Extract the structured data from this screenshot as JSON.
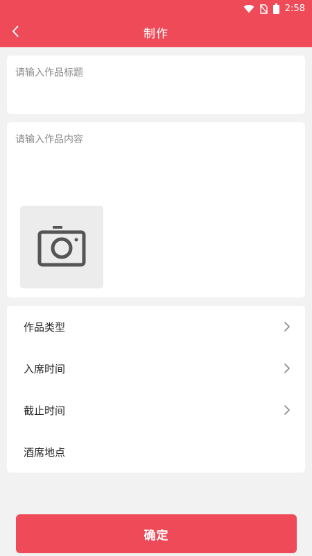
{
  "status_bar": {
    "time": "2:58",
    "icons": [
      "wifi-icon",
      "no-sim-icon",
      "battery-icon"
    ]
  },
  "header": {
    "title": "制作",
    "back_icon": "chevron-left-icon"
  },
  "form": {
    "title_placeholder": "请输入作品标题",
    "content_placeholder": "请输入作品内容",
    "photo_icon": "camera-icon"
  },
  "menu": {
    "items": [
      {
        "label": "作品类型",
        "chevron": true
      },
      {
        "label": "入席时间",
        "chevron": true
      },
      {
        "label": "截止时间",
        "chevron": true
      },
      {
        "label": "酒席地点",
        "chevron": false
      }
    ]
  },
  "confirm_label": "确定",
  "colors": {
    "primary": "#ef4a57",
    "background": "#f2f2f2",
    "card": "#ffffff",
    "placeholder": "#8a8a8a",
    "icon_gray": "#555555"
  }
}
